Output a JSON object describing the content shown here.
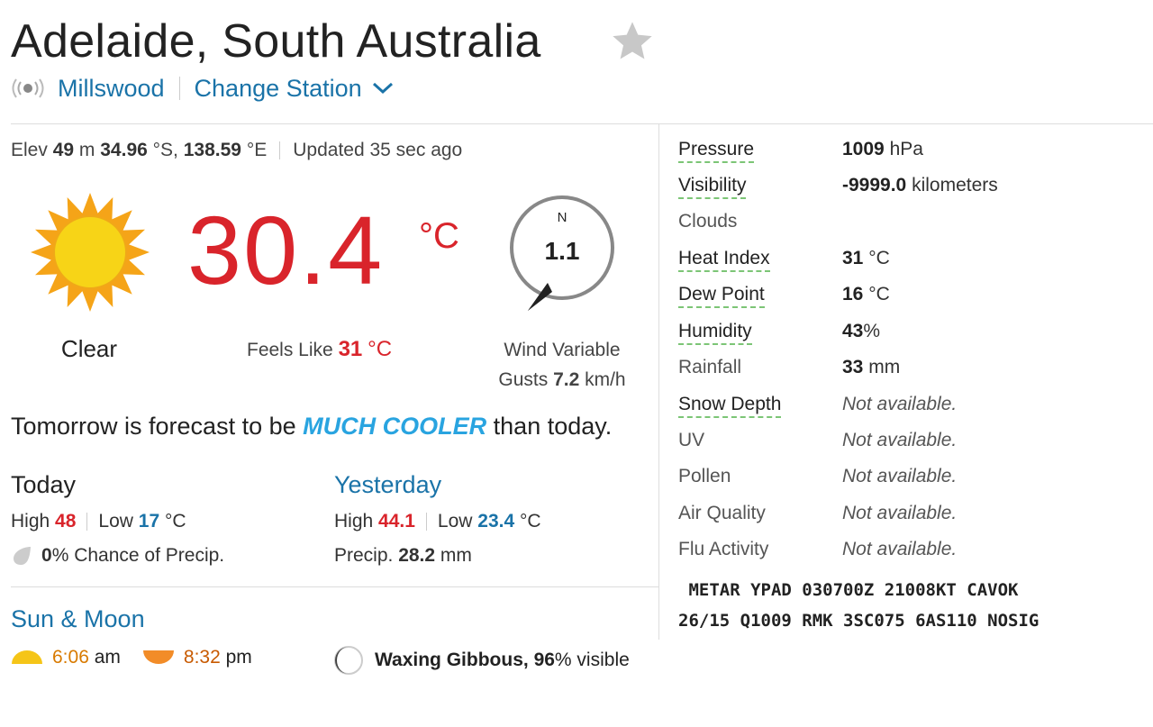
{
  "header": {
    "title": "Adelaide, South Australia",
    "station_name": "Millswood",
    "change_station": "Change Station"
  },
  "meta": {
    "elev_label": "Elev",
    "elev_value": "49",
    "elev_unit": "m",
    "lat_value": "34.96",
    "lat_unit": "°S,",
    "lon_value": "138.59",
    "lon_unit": "°E",
    "updated_label": "Updated",
    "updated_value": "35 sec ago"
  },
  "current": {
    "condition": "Clear",
    "temperature": "30.4",
    "temp_unit": "°C",
    "feels_like_label": "Feels Like",
    "feels_like_value": "31",
    "feels_like_unit": "°C",
    "wind_direction": "N",
    "wind_speed": "1.1",
    "wind_label": "Wind Variable",
    "gusts_label": "Gusts",
    "gusts_value": "7.2",
    "gusts_unit": "km/h"
  },
  "forecast": {
    "prefix": "Tomorrow is forecast to be",
    "highlight": "MUCH COOLER",
    "suffix": "than today."
  },
  "today": {
    "heading": "Today",
    "high_label": "High",
    "high_value": "48",
    "low_label": "Low",
    "low_value": "17",
    "unit": "°C",
    "precip_value": "0",
    "precip_text": "% Chance of Precip."
  },
  "yesterday": {
    "heading": "Yesterday",
    "high_label": "High",
    "high_value": "44.1",
    "low_label": "Low",
    "low_value": "23.4",
    "unit": "°C",
    "precip_label": "Precip.",
    "precip_value": "28.2",
    "precip_unit": "mm"
  },
  "sun_moon": {
    "heading": "Sun & Moon",
    "sunrise_value": "6:06",
    "sunrise_unit": "am",
    "sunset_value": "8:32",
    "sunset_unit": "pm",
    "moon_phase": "Waxing Gibbous,",
    "moon_pct": "96",
    "moon_suffix": "% visible"
  },
  "conditions": [
    {
      "label": "Pressure",
      "value": "1009",
      "unit": "hPa"
    },
    {
      "label": "Visibility",
      "value": "-9999.0",
      "unit": "kilometers"
    },
    {
      "label": "Clouds",
      "value": "",
      "unit": ""
    },
    {
      "label": "Heat Index",
      "value": "31",
      "unit": "°C"
    },
    {
      "label": "Dew Point",
      "value": "16",
      "unit": "°C"
    },
    {
      "label": "Humidity",
      "value": "43",
      "unit": "%"
    },
    {
      "label": "Rainfall",
      "value": "33",
      "unit": "mm"
    },
    {
      "label": "Snow Depth",
      "na": "Not available."
    },
    {
      "label": "UV",
      "na": "Not available."
    },
    {
      "label": "Pollen",
      "na": "Not available."
    },
    {
      "label": "Air Quality",
      "na": "Not available."
    },
    {
      "label": "Flu Activity",
      "na": "Not available."
    }
  ],
  "metar": {
    "line1": " METAR YPAD 030700Z 21008KT CAVOK",
    "line2": "26/15 Q1009 RMK 3SC075 6AS110 NOSIG"
  },
  "colors": {
    "temp_red": "#d9242b",
    "link_blue": "#1a73a8",
    "cooler_blue": "#29a4e0",
    "sun_yellow": "#f5c518",
    "sunset_orange": "#f28c28"
  },
  "icons": {
    "favorite": "star-icon",
    "station": "signal-icon",
    "condition": "sun-icon",
    "wind": "compass-icon",
    "precip": "raindrop-icon",
    "sunrise": "sunrise-icon",
    "sunset": "sunset-icon",
    "moon": "moon-icon"
  }
}
